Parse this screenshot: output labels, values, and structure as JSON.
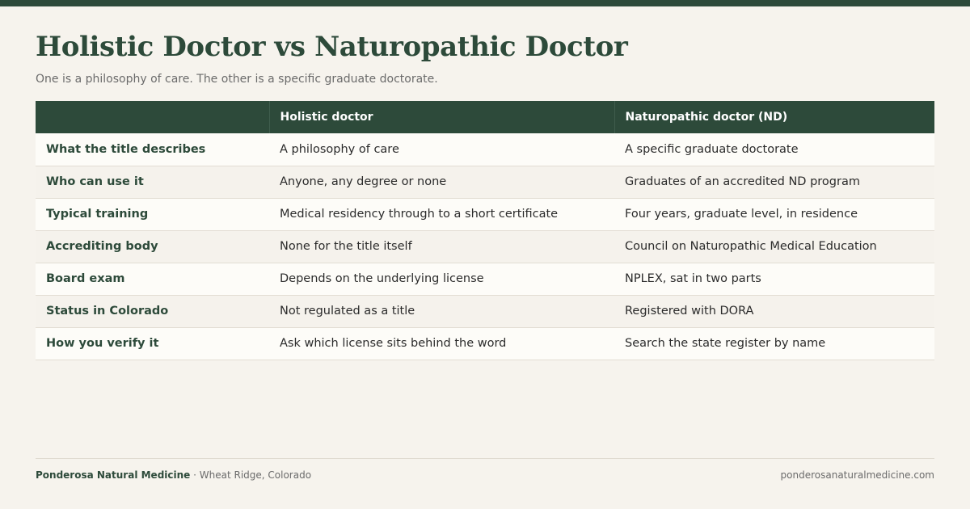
{
  "title": "Holistic Doctor vs Naturopathic Doctor",
  "subtitle": "One is a philosophy of care. The other is a specific graduate doctorate.",
  "table": {
    "headers": [
      "",
      "Holistic doctor",
      "Naturopathic doctor (ND)"
    ],
    "rows": [
      [
        "What the title describes",
        "A philosophy of care",
        "A specific graduate doctorate"
      ],
      [
        "Who can use it",
        "Anyone, any degree or none",
        "Graduates of an accredited ND program"
      ],
      [
        "Typical training",
        "Medical residency through to a short certificate",
        "Four years, graduate level, in residence"
      ],
      [
        "Accrediting body",
        "None for the title itself",
        "Council on Naturopathic Medical Education"
      ],
      [
        "Board exam",
        "Depends on the underlying license",
        "NPLEX, sat in two parts"
      ],
      [
        "Status in Colorado",
        "Not regulated as a title",
        "Registered with DORA"
      ],
      [
        "How you verify it",
        "Ask which license sits behind the word",
        "Search the state register by name"
      ]
    ]
  },
  "footer": {
    "brand": "Ponderosa Natural Medicine",
    "location": "· Wheat Ridge, Colorado",
    "url": "ponderosanaturalmedicine.com"
  },
  "colors": {
    "accent": "#2d4a3a",
    "background": "#f6f3ed"
  }
}
